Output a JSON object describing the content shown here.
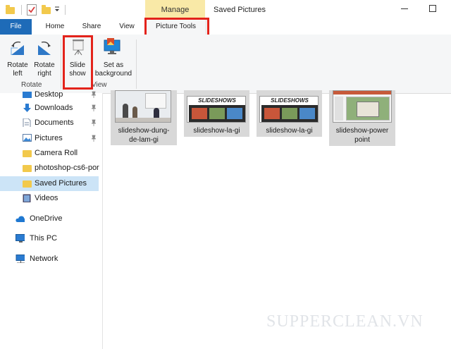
{
  "window": {
    "title": "Saved Pictures",
    "context_tab": "Manage"
  },
  "ribbon": {
    "tabs": [
      "File",
      "Home",
      "Share",
      "View",
      "Picture Tools"
    ],
    "buttons": {
      "rotate_left": [
        "Rotate",
        "left"
      ],
      "rotate_right": [
        "Rotate",
        "right"
      ],
      "slide_show": [
        "Slide",
        "show"
      ],
      "set_background": [
        "Set as",
        "background"
      ]
    },
    "groups": {
      "rotate": "Rotate",
      "view": "View"
    }
  },
  "nav": {
    "items": [
      {
        "label": "Desktop",
        "icon": "desktop-icon",
        "pinned": true
      },
      {
        "label": "Downloads",
        "icon": "download-arrow-icon",
        "pinned": true
      },
      {
        "label": "Documents",
        "icon": "document-icon",
        "pinned": true
      },
      {
        "label": "Pictures",
        "icon": "picture-icon",
        "pinned": true
      },
      {
        "label": "Camera Roll",
        "icon": "folder-icon",
        "pinned": false
      },
      {
        "label": "photoshop-cs6-por",
        "icon": "folder-icon",
        "pinned": false
      },
      {
        "label": "Saved Pictures",
        "icon": "folder-icon",
        "pinned": false,
        "selected": true
      },
      {
        "label": "Videos",
        "icon": "video-icon",
        "pinned": false
      },
      {
        "label": "OneDrive",
        "icon": "cloud-icon"
      },
      {
        "label": "This PC",
        "icon": "computer-icon"
      },
      {
        "label": "Network",
        "icon": "network-icon"
      }
    ]
  },
  "files": [
    {
      "name": [
        "slideshow-dung-",
        "de-lam-gi"
      ],
      "thumb": "classroom-photo"
    },
    {
      "name": [
        "slideshow-la-gi"
      ],
      "thumb": "slideshows-banner",
      "banner_text": "SLIDESHOWS"
    },
    {
      "name": [
        "slideshow-la-gi"
      ],
      "thumb": "slideshows-banner",
      "banner_text": "SLIDESHOWS"
    },
    {
      "name": [
        "slideshow-power",
        "point"
      ],
      "thumb": "powerpoint-window"
    }
  ],
  "watermark": "SUPPERCLEAN.VN",
  "colors": {
    "file_tab": "#1e6bb8",
    "manage_tab": "#f9e9a7",
    "highlight_box": "#e3231b",
    "selected_item": "#cce4f7",
    "tile_bg": "#d8d8d8"
  }
}
